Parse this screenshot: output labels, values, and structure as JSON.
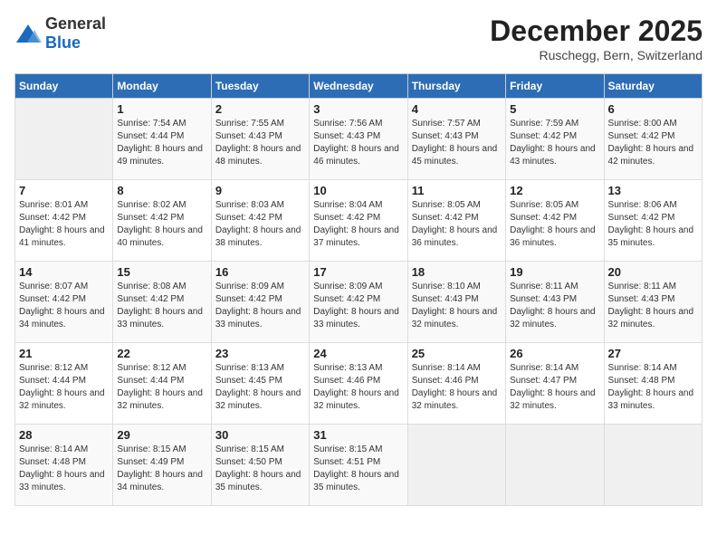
{
  "logo": {
    "general": "General",
    "blue": "Blue"
  },
  "header": {
    "month": "December 2025",
    "location": "Ruschegg, Bern, Switzerland"
  },
  "days_of_week": [
    "Sunday",
    "Monday",
    "Tuesday",
    "Wednesday",
    "Thursday",
    "Friday",
    "Saturday"
  ],
  "weeks": [
    [
      {
        "day": "",
        "sunrise": "",
        "sunset": "",
        "daylight": ""
      },
      {
        "day": "1",
        "sunrise": "Sunrise: 7:54 AM",
        "sunset": "Sunset: 4:44 PM",
        "daylight": "Daylight: 8 hours and 49 minutes."
      },
      {
        "day": "2",
        "sunrise": "Sunrise: 7:55 AM",
        "sunset": "Sunset: 4:43 PM",
        "daylight": "Daylight: 8 hours and 48 minutes."
      },
      {
        "day": "3",
        "sunrise": "Sunrise: 7:56 AM",
        "sunset": "Sunset: 4:43 PM",
        "daylight": "Daylight: 8 hours and 46 minutes."
      },
      {
        "day": "4",
        "sunrise": "Sunrise: 7:57 AM",
        "sunset": "Sunset: 4:43 PM",
        "daylight": "Daylight: 8 hours and 45 minutes."
      },
      {
        "day": "5",
        "sunrise": "Sunrise: 7:59 AM",
        "sunset": "Sunset: 4:42 PM",
        "daylight": "Daylight: 8 hours and 43 minutes."
      },
      {
        "day": "6",
        "sunrise": "Sunrise: 8:00 AM",
        "sunset": "Sunset: 4:42 PM",
        "daylight": "Daylight: 8 hours and 42 minutes."
      }
    ],
    [
      {
        "day": "7",
        "sunrise": "Sunrise: 8:01 AM",
        "sunset": "Sunset: 4:42 PM",
        "daylight": "Daylight: 8 hours and 41 minutes."
      },
      {
        "day": "8",
        "sunrise": "Sunrise: 8:02 AM",
        "sunset": "Sunset: 4:42 PM",
        "daylight": "Daylight: 8 hours and 40 minutes."
      },
      {
        "day": "9",
        "sunrise": "Sunrise: 8:03 AM",
        "sunset": "Sunset: 4:42 PM",
        "daylight": "Daylight: 8 hours and 38 minutes."
      },
      {
        "day": "10",
        "sunrise": "Sunrise: 8:04 AM",
        "sunset": "Sunset: 4:42 PM",
        "daylight": "Daylight: 8 hours and 37 minutes."
      },
      {
        "day": "11",
        "sunrise": "Sunrise: 8:05 AM",
        "sunset": "Sunset: 4:42 PM",
        "daylight": "Daylight: 8 hours and 36 minutes."
      },
      {
        "day": "12",
        "sunrise": "Sunrise: 8:05 AM",
        "sunset": "Sunset: 4:42 PM",
        "daylight": "Daylight: 8 hours and 36 minutes."
      },
      {
        "day": "13",
        "sunrise": "Sunrise: 8:06 AM",
        "sunset": "Sunset: 4:42 PM",
        "daylight": "Daylight: 8 hours and 35 minutes."
      }
    ],
    [
      {
        "day": "14",
        "sunrise": "Sunrise: 8:07 AM",
        "sunset": "Sunset: 4:42 PM",
        "daylight": "Daylight: 8 hours and 34 minutes."
      },
      {
        "day": "15",
        "sunrise": "Sunrise: 8:08 AM",
        "sunset": "Sunset: 4:42 PM",
        "daylight": "Daylight: 8 hours and 33 minutes."
      },
      {
        "day": "16",
        "sunrise": "Sunrise: 8:09 AM",
        "sunset": "Sunset: 4:42 PM",
        "daylight": "Daylight: 8 hours and 33 minutes."
      },
      {
        "day": "17",
        "sunrise": "Sunrise: 8:09 AM",
        "sunset": "Sunset: 4:42 PM",
        "daylight": "Daylight: 8 hours and 33 minutes."
      },
      {
        "day": "18",
        "sunrise": "Sunrise: 8:10 AM",
        "sunset": "Sunset: 4:43 PM",
        "daylight": "Daylight: 8 hours and 32 minutes."
      },
      {
        "day": "19",
        "sunrise": "Sunrise: 8:11 AM",
        "sunset": "Sunset: 4:43 PM",
        "daylight": "Daylight: 8 hours and 32 minutes."
      },
      {
        "day": "20",
        "sunrise": "Sunrise: 8:11 AM",
        "sunset": "Sunset: 4:43 PM",
        "daylight": "Daylight: 8 hours and 32 minutes."
      }
    ],
    [
      {
        "day": "21",
        "sunrise": "Sunrise: 8:12 AM",
        "sunset": "Sunset: 4:44 PM",
        "daylight": "Daylight: 8 hours and 32 minutes."
      },
      {
        "day": "22",
        "sunrise": "Sunrise: 8:12 AM",
        "sunset": "Sunset: 4:44 PM",
        "daylight": "Daylight: 8 hours and 32 minutes."
      },
      {
        "day": "23",
        "sunrise": "Sunrise: 8:13 AM",
        "sunset": "Sunset: 4:45 PM",
        "daylight": "Daylight: 8 hours and 32 minutes."
      },
      {
        "day": "24",
        "sunrise": "Sunrise: 8:13 AM",
        "sunset": "Sunset: 4:46 PM",
        "daylight": "Daylight: 8 hours and 32 minutes."
      },
      {
        "day": "25",
        "sunrise": "Sunrise: 8:14 AM",
        "sunset": "Sunset: 4:46 PM",
        "daylight": "Daylight: 8 hours and 32 minutes."
      },
      {
        "day": "26",
        "sunrise": "Sunrise: 8:14 AM",
        "sunset": "Sunset: 4:47 PM",
        "daylight": "Daylight: 8 hours and 32 minutes."
      },
      {
        "day": "27",
        "sunrise": "Sunrise: 8:14 AM",
        "sunset": "Sunset: 4:48 PM",
        "daylight": "Daylight: 8 hours and 33 minutes."
      }
    ],
    [
      {
        "day": "28",
        "sunrise": "Sunrise: 8:14 AM",
        "sunset": "Sunset: 4:48 PM",
        "daylight": "Daylight: 8 hours and 33 minutes."
      },
      {
        "day": "29",
        "sunrise": "Sunrise: 8:15 AM",
        "sunset": "Sunset: 4:49 PM",
        "daylight": "Daylight: 8 hours and 34 minutes."
      },
      {
        "day": "30",
        "sunrise": "Sunrise: 8:15 AM",
        "sunset": "Sunset: 4:50 PM",
        "daylight": "Daylight: 8 hours and 35 minutes."
      },
      {
        "day": "31",
        "sunrise": "Sunrise: 8:15 AM",
        "sunset": "Sunset: 4:51 PM",
        "daylight": "Daylight: 8 hours and 35 minutes."
      },
      {
        "day": "",
        "sunrise": "",
        "sunset": "",
        "daylight": ""
      },
      {
        "day": "",
        "sunrise": "",
        "sunset": "",
        "daylight": ""
      },
      {
        "day": "",
        "sunrise": "",
        "sunset": "",
        "daylight": ""
      }
    ]
  ]
}
